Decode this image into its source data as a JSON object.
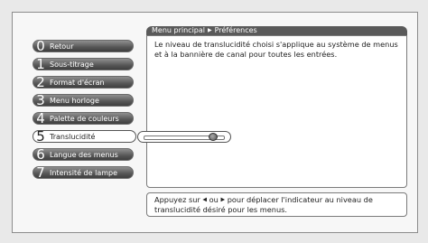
{
  "breadcrumb": {
    "root": "Menu principal",
    "separator": "▶",
    "current": "Préférences"
  },
  "menu": [
    {
      "num": "0",
      "label": "Retour"
    },
    {
      "num": "1",
      "label": "Sous-titrage"
    },
    {
      "num": "2",
      "label": "Format d'écran"
    },
    {
      "num": "3",
      "label": "Menu horloge"
    },
    {
      "num": "4",
      "label": "Palette de couleurs"
    },
    {
      "num": "5",
      "label": "Translucidité",
      "selected": true
    },
    {
      "num": "6",
      "label": "Langue des menus"
    },
    {
      "num": "7",
      "label": "Intensité de lampe"
    }
  ],
  "slider": {
    "value_fraction": 0.88
  },
  "description": "Le niveau de translucidité choisi s'applique au système de menus et à la bannière de canal pour toutes les entrées.",
  "hint": {
    "part1": "Appuyez sur",
    "left_arrow": "◀",
    "ou": "ou",
    "right_arrow": "▶",
    "part2": "pour déplacer l'indicateur au niveau de translucidité désiré pour les menus."
  }
}
